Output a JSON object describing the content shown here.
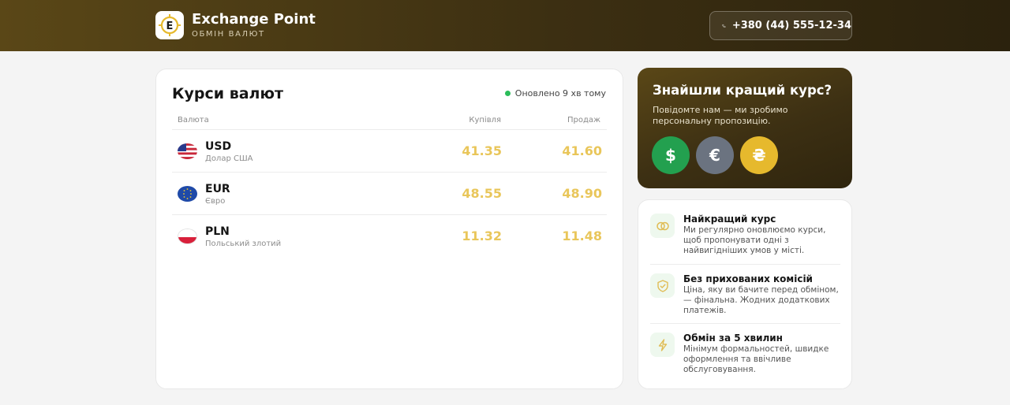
{
  "header": {
    "brand_title": "Exchange Point",
    "brand_subtitle": "ОБМІН ВАЛЮТ",
    "logo_letter": "E",
    "phone": "+380 (44) 555-12-34",
    "phone_icon": "phone-icon"
  },
  "rates": {
    "title": "Курси валют",
    "updated": "Оновлено 9 хв тому",
    "columns": {
      "currency": "Валюта",
      "buy": "Купівля",
      "sell": "Продаж"
    },
    "rows": [
      {
        "code": "USD",
        "name": "Долар США",
        "buy": "41.35",
        "sell": "41.60",
        "flag": "us-flag-icon"
      },
      {
        "code": "EUR",
        "name": "Євро",
        "buy": "48.55",
        "sell": "48.90",
        "flag": "eu-flag-icon"
      },
      {
        "code": "PLN",
        "name": "Польський злотий",
        "buy": "11.32",
        "sell": "11.48",
        "flag": "pl-flag-icon"
      }
    ]
  },
  "promo": {
    "title": "Знайшли кращий курс?",
    "text": "Повідомте нам — ми зробимо персональну пропозицію.",
    "coins": [
      {
        "symbol": "$",
        "color": "#23a04f"
      },
      {
        "symbol": "€",
        "color": "#6b7380"
      },
      {
        "symbol": "₴",
        "color": "#e6b92d"
      }
    ]
  },
  "features": [
    {
      "title": "Найкращий курс",
      "text": "Ми регулярно оновлюємо курси, щоб пропонувати одні з найвигідніших умов у місті.",
      "icon": "coins-icon"
    },
    {
      "title": "Без прихованих комісій",
      "text": "Ціна, яку ви бачите перед обміном, — фінальна. Жодних додаткових платежів.",
      "icon": "shield-icon"
    },
    {
      "title": "Обмін за 5 хвилин",
      "text": "Мінімум формальностей, швидке оформлення та ввічливе обслуговування.",
      "icon": "lightning-icon"
    }
  ],
  "colors": {
    "accent_gold": "#e9c65a",
    "header_brown": "#4a3a14",
    "status_green": "#2bbd5a"
  }
}
